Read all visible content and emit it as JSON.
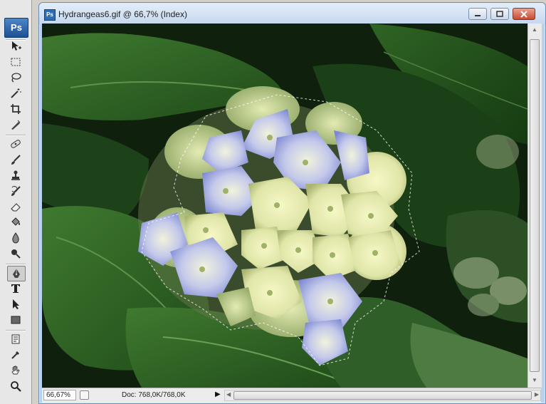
{
  "app": {
    "logo": "Ps"
  },
  "tools": [
    {
      "name": "move-tool",
      "icon": "move-icon"
    },
    {
      "name": "marquee-tool",
      "icon": "marquee-icon"
    },
    {
      "name": "lasso-tool",
      "icon": "lasso-icon"
    },
    {
      "name": "magic-wand-tool",
      "icon": "magic-wand-icon"
    },
    {
      "name": "crop-tool",
      "icon": "crop-icon"
    },
    {
      "name": "slice-tool",
      "icon": "slice-icon"
    },
    {
      "name": "healing-brush-tool",
      "icon": "bandage-icon"
    },
    {
      "name": "brush-tool",
      "icon": "brush-icon"
    },
    {
      "name": "clone-stamp-tool",
      "icon": "stamp-icon"
    },
    {
      "name": "history-brush-tool",
      "icon": "history-brush-icon"
    },
    {
      "name": "eraser-tool",
      "icon": "eraser-icon"
    },
    {
      "name": "paint-bucket-tool",
      "icon": "bucket-icon"
    },
    {
      "name": "blur-tool",
      "icon": "drop-icon"
    },
    {
      "name": "dodge-tool",
      "icon": "dodge-icon"
    },
    {
      "name": "pen-tool",
      "icon": "pen-icon"
    },
    {
      "name": "type-tool",
      "icon": "type-icon"
    },
    {
      "name": "path-selection-tool",
      "icon": "arrow-icon"
    },
    {
      "name": "shape-tool",
      "icon": "rectangle-icon"
    },
    {
      "name": "notes-tool",
      "icon": "note-icon"
    },
    {
      "name": "eyedropper-tool",
      "icon": "eyedropper-icon"
    },
    {
      "name": "hand-tool",
      "icon": "hand-icon"
    },
    {
      "name": "zoom-tool",
      "icon": "magnifier-icon"
    }
  ],
  "document": {
    "title": "Hydrangeas6.gif @ 66,7% (Index)",
    "icon_label": "Ps",
    "buttons": {
      "minimize": "minimize-icon",
      "maximize": "maximize-icon",
      "close": "close-icon"
    }
  },
  "status_bar": {
    "zoom": "66,67%",
    "doc_size": "Doc: 768,0K/768,0K"
  },
  "colors": {
    "window_frame": "#b9d1ea",
    "canvas_bg": "#0f200d",
    "close_button": "#c84a31"
  }
}
